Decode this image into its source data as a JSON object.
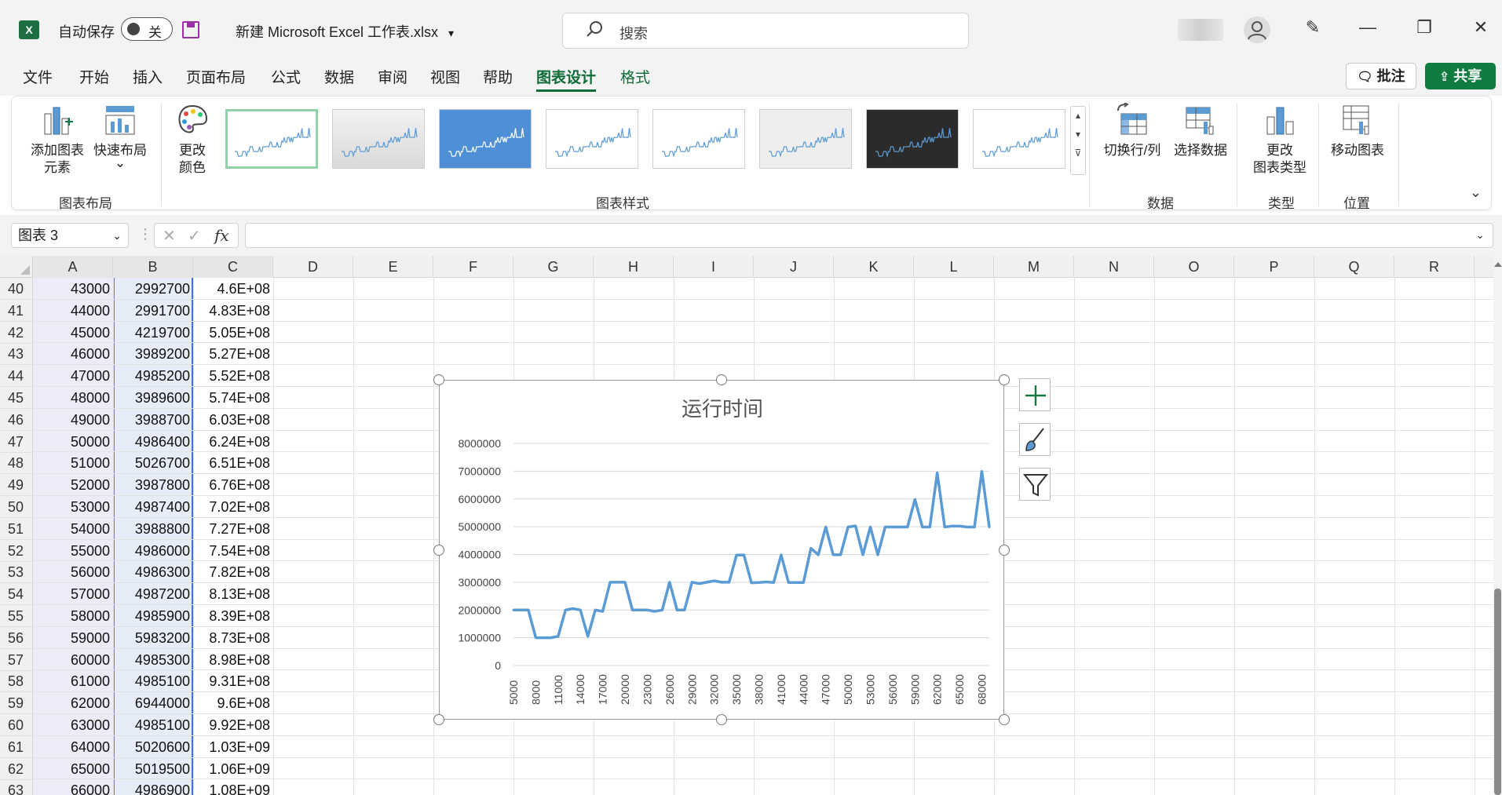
{
  "titlebar": {
    "app_icon": "X",
    "autosave_label": "自动保存",
    "autosave_state": "关",
    "filename": "新建 Microsoft Excel 工作表.xlsx",
    "filename_dropdown": "▾",
    "search_placeholder": "搜索",
    "minimize": "—",
    "restore": "❐",
    "close": "✕",
    "pen": "✎",
    "user_glyph": "👤"
  },
  "menu": {
    "items": [
      "文件",
      "开始",
      "插入",
      "页面布局",
      "公式",
      "数据",
      "审阅",
      "视图",
      "帮助",
      "图表设计",
      "格式"
    ],
    "active": "图表设计",
    "comment_button": "批注",
    "share_button": "共享"
  },
  "ribbon": {
    "add_element": "添加图表\n元素",
    "quick_layout": "快速布局",
    "group_layout": "图表布局",
    "change_color": "更改\n颜色",
    "group_styles": "图表样式",
    "switch_row_col": "切换行/列",
    "select_data": "选择数据",
    "group_data": "数据",
    "change_type": "更改\n图表类型",
    "group_type": "类型",
    "move_chart": "移动图表",
    "group_location": "位置",
    "dropdown": "⌄"
  },
  "formula_bar": {
    "name_box": "图表 3",
    "fx": "fx",
    "cancel": "✕",
    "enter": "✓",
    "value": ""
  },
  "sheet": {
    "columns": [
      "A",
      "B",
      "C",
      "D",
      "E",
      "F",
      "G",
      "H",
      "I",
      "J",
      "K",
      "L",
      "M",
      "N",
      "O",
      "P",
      "Q",
      "R"
    ],
    "rows": [
      {
        "num": "40",
        "a": "43000",
        "b": "2992700",
        "c": "4.6E+08"
      },
      {
        "num": "41",
        "a": "44000",
        "b": "2991700",
        "c": "4.83E+08"
      },
      {
        "num": "42",
        "a": "45000",
        "b": "4219700",
        "c": "5.05E+08"
      },
      {
        "num": "43",
        "a": "46000",
        "b": "3989200",
        "c": "5.27E+08"
      },
      {
        "num": "44",
        "a": "47000",
        "b": "4985200",
        "c": "5.52E+08"
      },
      {
        "num": "45",
        "a": "48000",
        "b": "3989600",
        "c": "5.74E+08"
      },
      {
        "num": "46",
        "a": "49000",
        "b": "3988700",
        "c": "6.03E+08"
      },
      {
        "num": "47",
        "a": "50000",
        "b": "4986400",
        "c": "6.24E+08"
      },
      {
        "num": "48",
        "a": "51000",
        "b": "5026700",
        "c": "6.51E+08"
      },
      {
        "num": "49",
        "a": "52000",
        "b": "3987800",
        "c": "6.76E+08"
      },
      {
        "num": "50",
        "a": "53000",
        "b": "4987400",
        "c": "7.02E+08"
      },
      {
        "num": "51",
        "a": "54000",
        "b": "3988800",
        "c": "7.27E+08"
      },
      {
        "num": "52",
        "a": "55000",
        "b": "4986000",
        "c": "7.54E+08"
      },
      {
        "num": "53",
        "a": "56000",
        "b": "4986300",
        "c": "7.82E+08"
      },
      {
        "num": "54",
        "a": "57000",
        "b": "4987200",
        "c": "8.13E+08"
      },
      {
        "num": "55",
        "a": "58000",
        "b": "4985900",
        "c": "8.39E+08"
      },
      {
        "num": "56",
        "a": "59000",
        "b": "5983200",
        "c": "8.73E+08"
      },
      {
        "num": "57",
        "a": "60000",
        "b": "4985300",
        "c": "8.98E+08"
      },
      {
        "num": "58",
        "a": "61000",
        "b": "4985100",
        "c": "9.31E+08"
      },
      {
        "num": "59",
        "a": "62000",
        "b": "6944000",
        "c": "9.6E+08"
      },
      {
        "num": "60",
        "a": "63000",
        "b": "4985100",
        "c": "9.92E+08"
      },
      {
        "num": "61",
        "a": "64000",
        "b": "5020600",
        "c": "1.03E+09"
      },
      {
        "num": "62",
        "a": "65000",
        "b": "5019500",
        "c": "1.06E+09"
      },
      {
        "num": "63",
        "a": "66000",
        "b": "4986900",
        "c": "1.08E+09"
      }
    ]
  },
  "colors": {
    "accent": "#107c41",
    "series": "#5b9bd5",
    "col_a_shade": "#eeebf8",
    "col_b_shade": "#e7ecf9"
  },
  "chart_data": {
    "type": "line",
    "title": "运行时间",
    "ylim": [
      0,
      8000000
    ],
    "y_ticks": [
      "8000000",
      "7000000",
      "6000000",
      "5000000",
      "4000000",
      "3000000",
      "2000000",
      "1000000",
      "0"
    ],
    "x_tick_labels": [
      "5000",
      "8000",
      "11000",
      "14000",
      "17000",
      "20000",
      "23000",
      "26000",
      "29000",
      "32000",
      "35000",
      "38000",
      "41000",
      "44000",
      "47000",
      "50000",
      "53000",
      "56000",
      "59000",
      "62000",
      "65000",
      "68000"
    ],
    "grid": true,
    "legend": "none",
    "x": [
      5000,
      6000,
      7000,
      8000,
      9000,
      10000,
      11000,
      12000,
      13000,
      14000,
      15000,
      16000,
      17000,
      18000,
      19000,
      20000,
      21000,
      22000,
      23000,
      24000,
      25000,
      26000,
      27000,
      28000,
      29000,
      30000,
      31000,
      32000,
      33000,
      34000,
      35000,
      36000,
      37000,
      38000,
      39000,
      40000,
      41000,
      42000,
      43000,
      44000,
      45000,
      46000,
      47000,
      48000,
      49000,
      50000,
      51000,
      52000,
      53000,
      54000,
      55000,
      56000,
      57000,
      58000,
      59000,
      60000,
      61000,
      62000,
      63000,
      64000,
      65000,
      66000,
      67000,
      68000,
      69000
    ],
    "values": [
      2000000,
      2000000,
      2000000,
      1000000,
      1000000,
      1000000,
      1050000,
      2000000,
      2050000,
      2000000,
      1050000,
      2000000,
      1950000,
      3000000,
      3000000,
      3000000,
      2000000,
      2000000,
      2000000,
      1950000,
      2000000,
      3000000,
      2000000,
      2000000,
      3000000,
      2950000,
      3000000,
      3050000,
      3000000,
      3000000,
      3980000,
      3980000,
      2980000,
      2990000,
      3010000,
      2990000,
      3980000,
      2990000,
      2990000,
      2990000,
      4220000,
      3990000,
      4990000,
      3990000,
      3990000,
      4990000,
      5030000,
      3990000,
      4990000,
      3990000,
      4990000,
      4990000,
      4990000,
      4990000,
      5980000,
      4990000,
      4990000,
      6940000,
      4990000,
      5020000,
      5020000,
      4990000,
      4990000,
      6990000,
      4990000
    ]
  }
}
